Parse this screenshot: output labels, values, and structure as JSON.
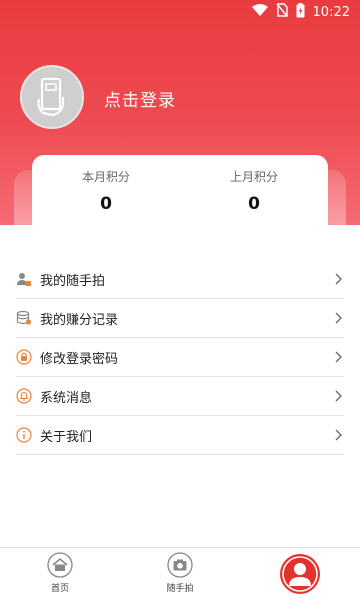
{
  "status_bar": {
    "time": "10:22"
  },
  "profile": {
    "login_text": "点击登录"
  },
  "points": {
    "this_month_label": "本月积分",
    "this_month_value": "0",
    "last_month_label": "上月积分",
    "last_month_value": "0"
  },
  "menu": [
    {
      "label": "我的随手拍",
      "icon": "user-camera-icon"
    },
    {
      "label": "我的赚分记录",
      "icon": "database-icon"
    },
    {
      "label": "修改登录密码",
      "icon": "lock-icon"
    },
    {
      "label": "系统消息",
      "icon": "bell-icon"
    },
    {
      "label": "关于我们",
      "icon": "info-icon"
    }
  ],
  "bottom_nav": {
    "home_label": "首页",
    "snap_label": "随手拍"
  },
  "colors": {
    "brand_red": "#e93b3f",
    "icon_orange": "#e8833a"
  }
}
